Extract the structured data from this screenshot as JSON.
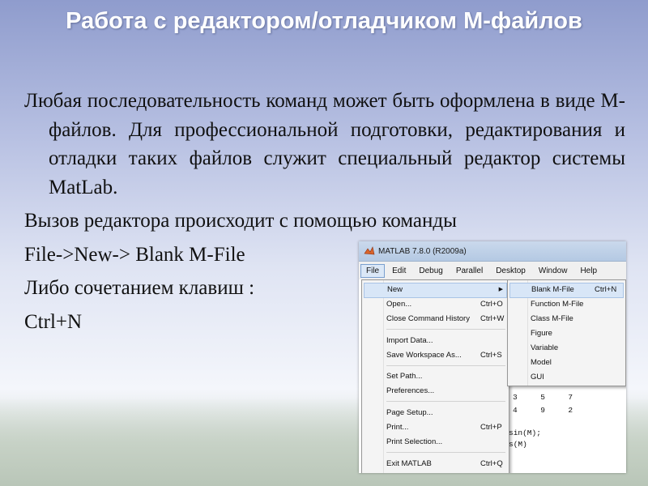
{
  "slide": {
    "title": "Работа с редактором/отладчиком М-файлов",
    "paragraph1": "Любая последовательность команд может быть оформлена в виде М-файлов. Для профессиональной подготовки, редактирования и отладки таких файлов служит специальный редактор системы MatLab.",
    "line2": "Вызов редактора происходит с помощью команды",
    "line3": "File->New-> Blank M-File",
    "line4": "Либо сочетанием клавиш :",
    "line5": "Ctrl+N"
  },
  "matlab": {
    "window_title": "MATLAB  7.8.0 (R2009a)",
    "menubar": [
      "File",
      "Edit",
      "Debug",
      "Parallel",
      "Desktop",
      "Window",
      "Help"
    ],
    "file_menu": [
      {
        "label": "New",
        "shortcut": ""
      },
      {
        "label": "Open...",
        "shortcut": "Ctrl+O"
      },
      {
        "label": "Close Command History",
        "shortcut": "Ctrl+W"
      },
      {
        "label": "Import Data...",
        "shortcut": ""
      },
      {
        "label": "Save Workspace As...",
        "shortcut": "Ctrl+S"
      },
      {
        "label": "Set Path...",
        "shortcut": ""
      },
      {
        "label": "Preferences...",
        "shortcut": ""
      },
      {
        "label": "Page Setup...",
        "shortcut": ""
      },
      {
        "label": "Print...",
        "shortcut": "Ctrl+P"
      },
      {
        "label": "Print Selection...",
        "shortcut": ""
      },
      {
        "label": "Exit MATLAB",
        "shortcut": "Ctrl+Q"
      }
    ],
    "new_submenu": [
      {
        "label": "Blank M-File",
        "shortcut": "Ctrl+N"
      },
      {
        "label": "Function M-File",
        "shortcut": ""
      },
      {
        "label": "Class M-File",
        "shortcut": ""
      },
      {
        "label": "Figure",
        "shortcut": ""
      },
      {
        "label": "Variable",
        "shortcut": ""
      },
      {
        "label": "Model",
        "shortcut": ""
      },
      {
        "label": "GUI",
        "shortcut": ""
      }
    ],
    "background_code": {
      "row1": "3     5     7",
      "row2": "4     9     2",
      "line3": "sin(M);",
      "line4": "s(M)"
    }
  }
}
